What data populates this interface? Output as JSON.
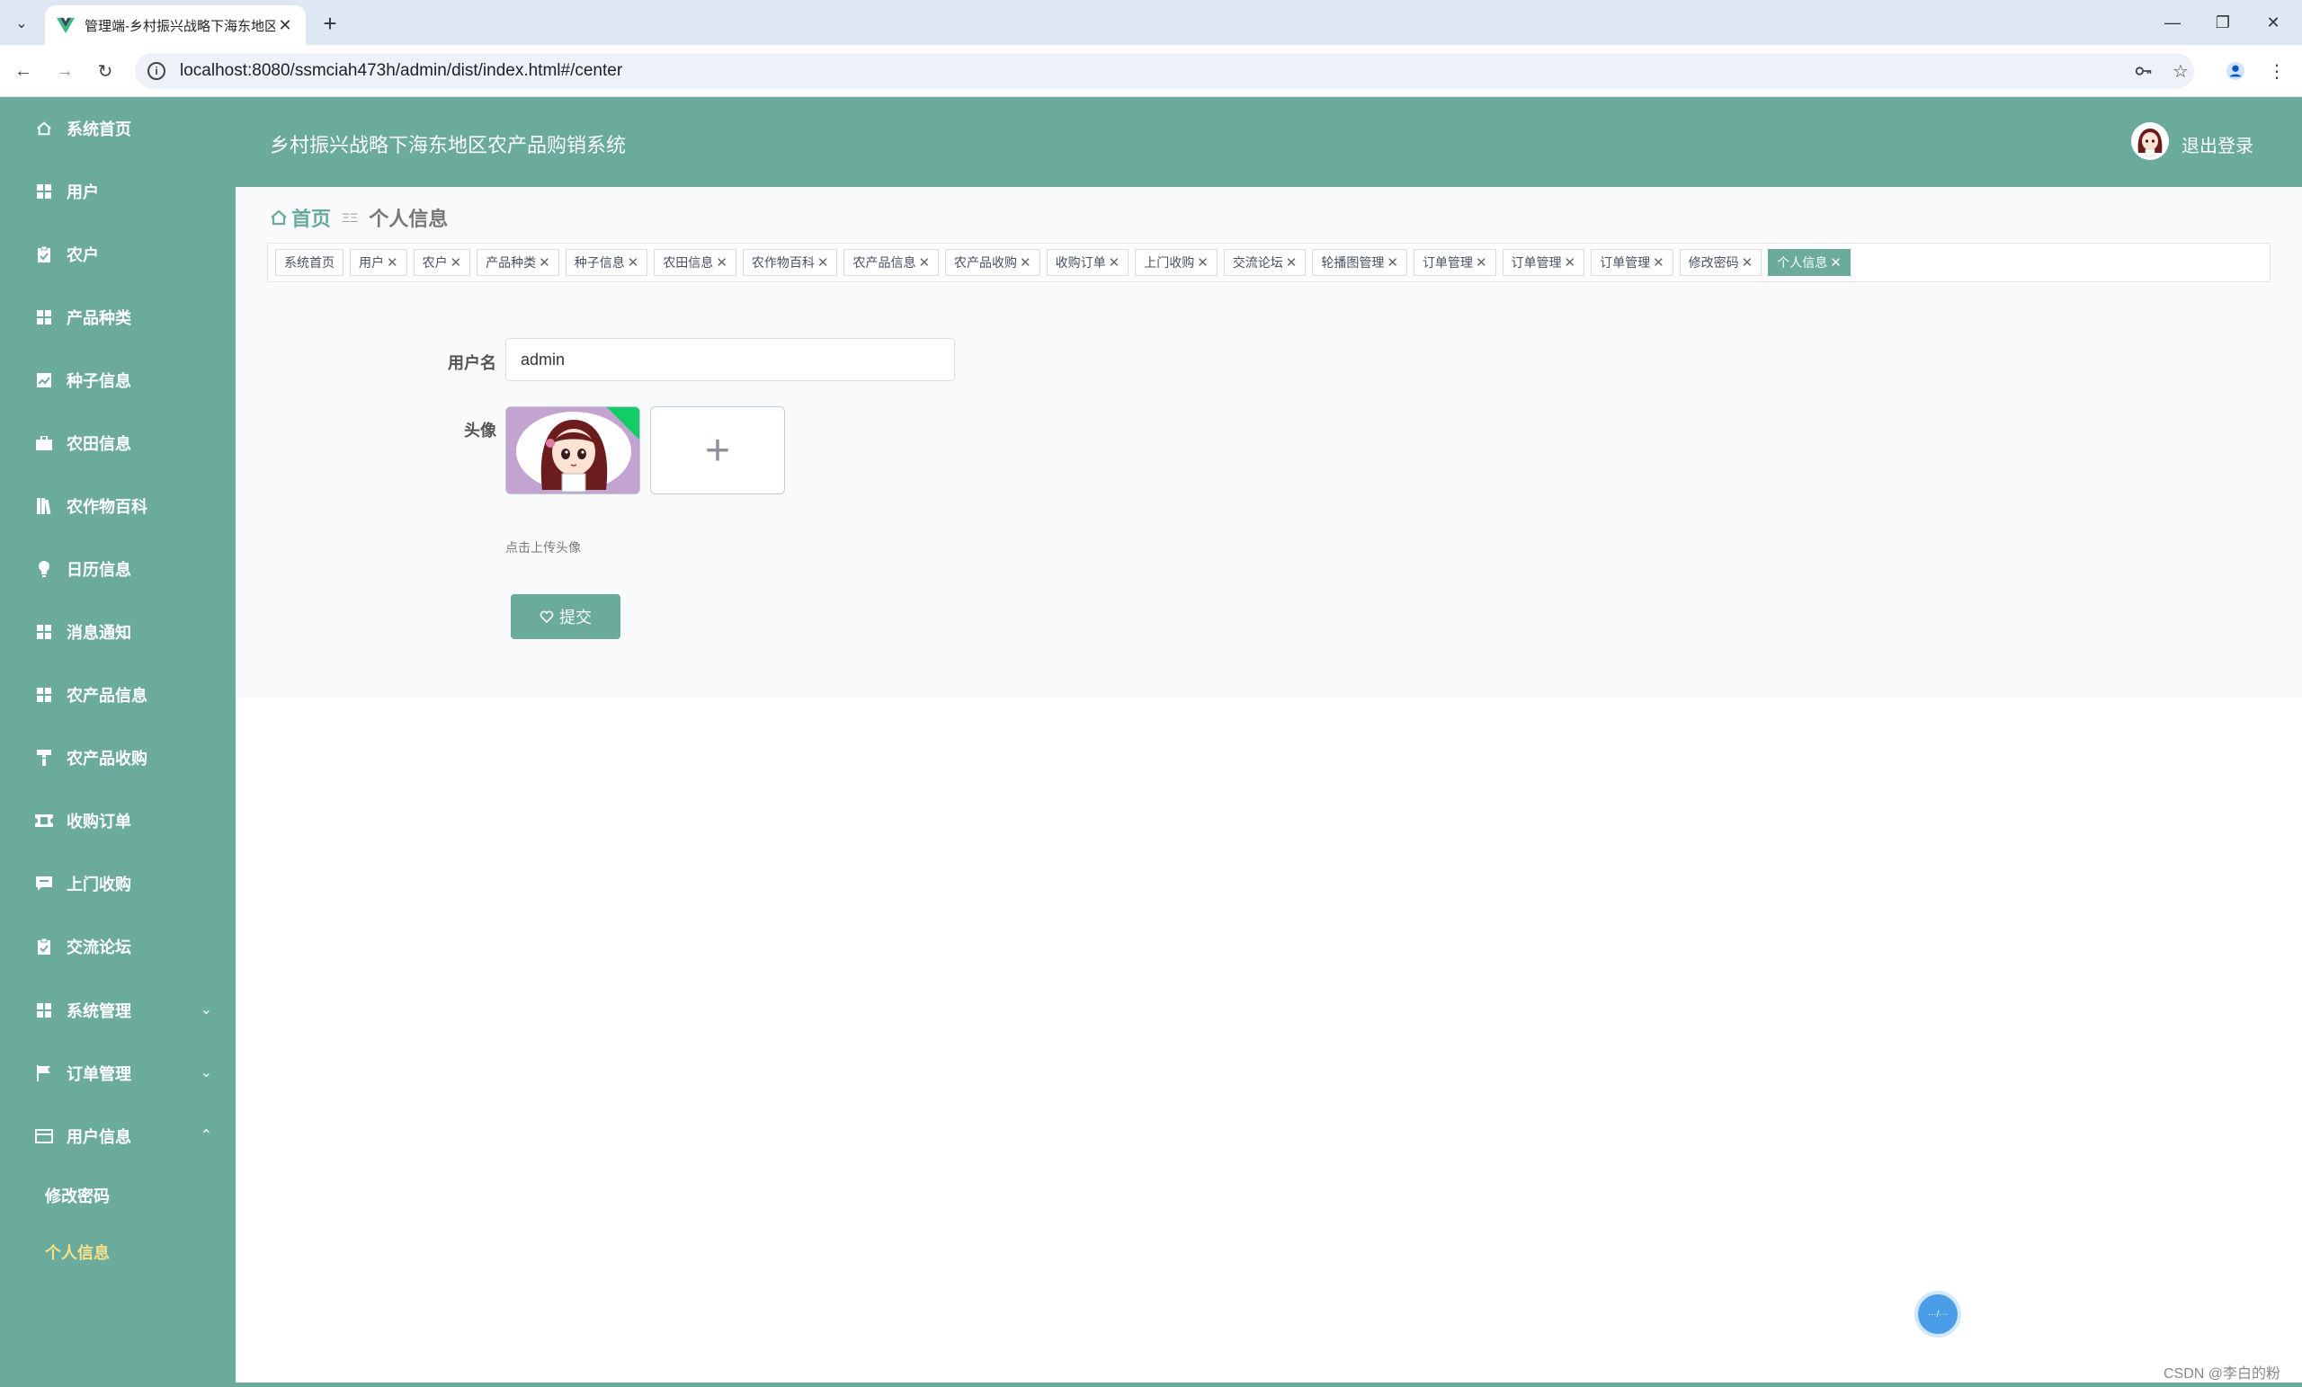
{
  "browser": {
    "tab_title": "管理端-乡村振兴战略下海东地区",
    "url": "localhost:8080/ssmciah473h/admin/dist/index.html#/center"
  },
  "header": {
    "app_title": "乡村振兴战略下海东地区农产品购销系统",
    "logout": "退出登录"
  },
  "sidebar": {
    "items": [
      {
        "label": "系统首页",
        "icon": "home-icon"
      },
      {
        "label": "用户",
        "icon": "grid-icon"
      },
      {
        "label": "农户",
        "icon": "clipboard-icon"
      },
      {
        "label": "产品种类",
        "icon": "grid-icon"
      },
      {
        "label": "种子信息",
        "icon": "chart-icon"
      },
      {
        "label": "农田信息",
        "icon": "briefcase-icon"
      },
      {
        "label": "农作物百科",
        "icon": "book-icon"
      },
      {
        "label": "日历信息",
        "icon": "lightbulb-icon"
      },
      {
        "label": "消息通知",
        "icon": "grid-icon"
      },
      {
        "label": "农产品信息",
        "icon": "grid-icon"
      },
      {
        "label": "农产品收购",
        "icon": "paint-roller-icon"
      },
      {
        "label": "收购订单",
        "icon": "ticket-icon"
      },
      {
        "label": "上门收购",
        "icon": "message-icon"
      },
      {
        "label": "交流论坛",
        "icon": "clipboard-check-icon"
      },
      {
        "label": "系统管理",
        "icon": "grid-icon"
      },
      {
        "label": "订单管理",
        "icon": "flag-icon"
      },
      {
        "label": "用户信息",
        "icon": "credit-card-icon"
      }
    ],
    "sub_items": [
      {
        "label": "修改密码"
      },
      {
        "label": "个人信息"
      }
    ]
  },
  "breadcrumb": {
    "home": "首页",
    "separator": "ΞΞ",
    "current": "个人信息"
  },
  "tags": [
    {
      "label": "系统首页",
      "closable": false
    },
    {
      "label": "用户",
      "closable": true
    },
    {
      "label": "农户",
      "closable": true
    },
    {
      "label": "产品种类",
      "closable": true
    },
    {
      "label": "种子信息",
      "closable": true
    },
    {
      "label": "农田信息",
      "closable": true
    },
    {
      "label": "农作物百科",
      "closable": true
    },
    {
      "label": "农产品信息",
      "closable": true
    },
    {
      "label": "农产品收购",
      "closable": true
    },
    {
      "label": "收购订单",
      "closable": true
    },
    {
      "label": "上门收购",
      "closable": true
    },
    {
      "label": "交流论坛",
      "closable": true
    },
    {
      "label": "轮播图管理",
      "closable": true
    },
    {
      "label": "订单管理",
      "closable": true
    },
    {
      "label": "订单管理",
      "closable": true
    },
    {
      "label": "订单管理",
      "closable": true
    },
    {
      "label": "修改密码",
      "closable": true
    },
    {
      "label": "个人信息",
      "closable": true,
      "active": true
    }
  ],
  "form": {
    "username_label": "用户名",
    "username_value": "admin",
    "avatar_label": "头像",
    "upload_tip": "点击上传头像",
    "submit_label": "提交"
  },
  "float_ball_text": "···/···",
  "watermark": "CSDN @李白的粉",
  "colors": {
    "theme": "#6aab9b",
    "active_sub": "#f7e08a",
    "success_corner": "#13ce66"
  }
}
